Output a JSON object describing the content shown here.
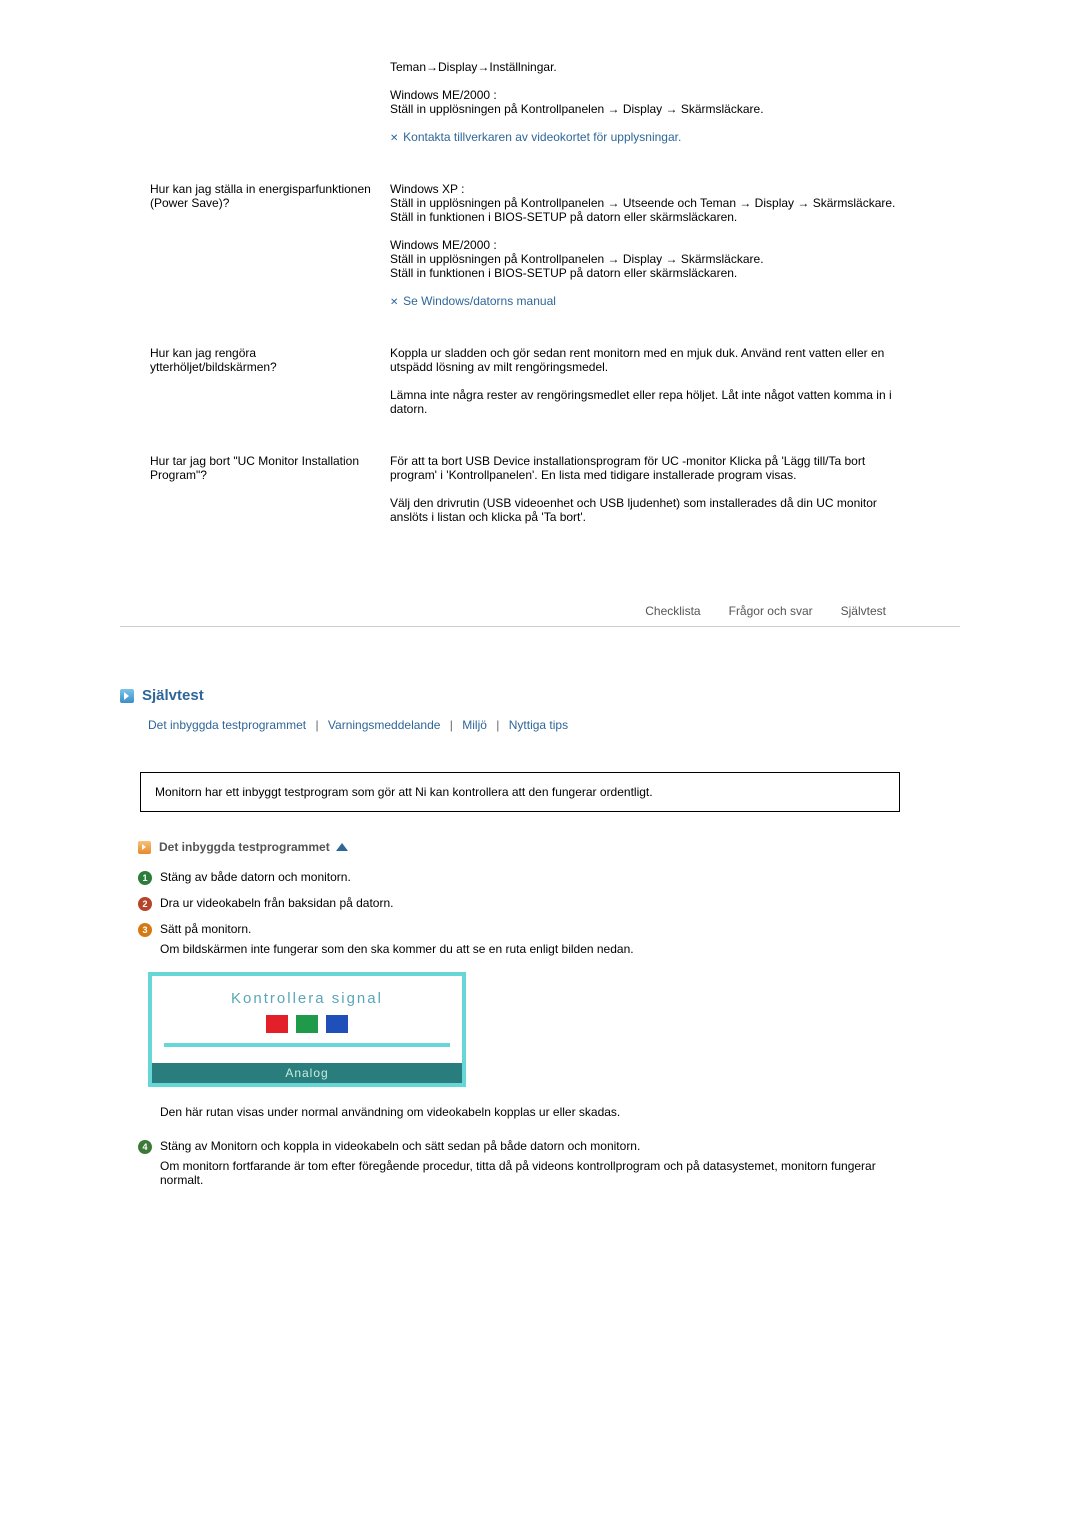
{
  "faq": [
    {
      "question": "",
      "answer": [
        "Teman→Display→Inställningar.",
        "Windows ME/2000 :\nStäll in upplösningen på Kontrollpanelen → Display → Skärmsläckare."
      ],
      "note": "Kontakta tillverkaren av videokortet för upplysningar."
    },
    {
      "question": "Hur kan jag ställa in energisparfunktionen (Power Save)?",
      "answer": [
        "Windows XP :\nStäll in upplösningen på Kontrollpanelen → Utseende och Teman → Display → Skärmsläckare.\nStäll in funktionen i BIOS-SETUP på datorn eller skärmsläckaren.",
        "Windows ME/2000 :\nStäll in upplösningen på Kontrollpanelen → Display → Skärmsläckare.\nStäll in funktionen i BIOS-SETUP på datorn eller skärmsläckaren."
      ],
      "note": "Se Windows/datorns manual"
    },
    {
      "question": "Hur kan jag rengöra ytterhöljet/bildskärmen?",
      "answer": [
        "Koppla ur sladden och gör sedan rent monitorn med en mjuk duk. Använd rent vatten eller en utspädd lösning av milt rengöringsmedel.",
        "Lämna inte några rester av rengöringsmedlet eller repa höljet. Låt inte något vatten komma in i datorn."
      ],
      "note": ""
    },
    {
      "question": "Hur tar jag bort \"UC Monitor Installation Program\"?",
      "answer": [
        "För att ta bort USB Device installationsprogram för UC -monitor Klicka på 'Lägg till/Ta bort program' i 'Kontrollpanelen'. En lista med tidigare installerade program visas.",
        "Välj den drivrutin (USB videoenhet och USB ljudenhet) som installerades då din UC monitor anslöts i listan och klicka på 'Ta bort'."
      ],
      "note": ""
    }
  ],
  "tabs": [
    "Checklista",
    "Frågor och svar",
    "Självtest"
  ],
  "section_title": "Självtest",
  "subnav": [
    "Det inbyggda testprogrammet",
    "Varningsmeddelande",
    "Miljö",
    "Nyttiga tips"
  ],
  "info_box": "Monitorn har ett inbyggt testprogram som gör att Ni kan kontrollera att den fungerar ordentligt.",
  "sub_header": "Det inbyggda testprogrammet",
  "steps": [
    {
      "lines": [
        "Stäng av både datorn och monitorn."
      ]
    },
    {
      "lines": [
        "Dra ur videokabeln från baksidan på datorn."
      ]
    },
    {
      "lines": [
        "Sätt på monitorn.",
        "Om bildskärmen inte fungerar som den ska kommer du att se en ruta enligt bilden nedan."
      ]
    }
  ],
  "signal": {
    "title": "Kontrollera signal",
    "footer": "Analog"
  },
  "signal_caption": "Den här rutan visas under normal användning om videokabeln kopplas ur eller skadas.",
  "step4": {
    "lines": [
      "Stäng av Monitorn och koppla in videokabeln och sätt sedan på både datorn och monitorn.",
      "Om monitorn fortfarande är tom efter föregående procedur, titta då på videons kontrollprogram och på datasystemet, monitorn fungerar normalt."
    ]
  }
}
